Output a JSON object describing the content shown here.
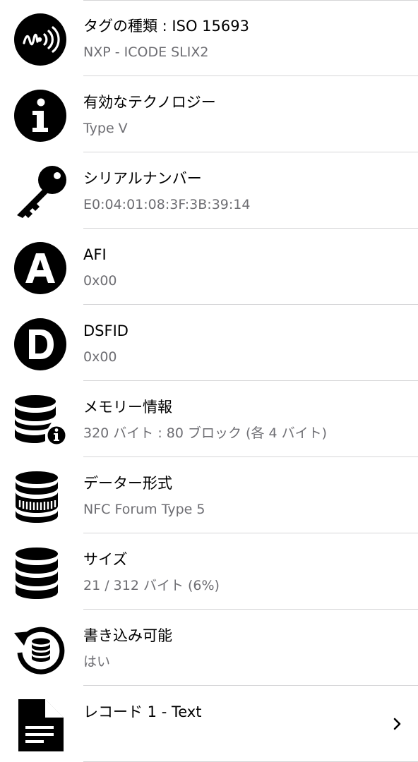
{
  "rows": [
    {
      "icon": "nfc-signal-icon",
      "title": "タグの種類 : ISO 15693",
      "value": "NXP - ICODE SLIX2"
    },
    {
      "icon": "info-icon",
      "title": "有効なテクノロジー",
      "value": "Type V"
    },
    {
      "icon": "key-icon",
      "title": "シリアルナンバー",
      "value": "E0:04:01:08:3F:3B:39:14"
    },
    {
      "icon": "letter-a-icon",
      "title": "AFI",
      "value": "0x00"
    },
    {
      "icon": "letter-d-icon",
      "title": "DSFID",
      "value": "0x00"
    },
    {
      "icon": "database-info-icon",
      "title": "メモリー情報",
      "value": "320 バイト : 80 ブロック (各 4 バイト)"
    },
    {
      "icon": "database-format-icon",
      "title": "データー形式",
      "value": "NFC Forum Type 5"
    },
    {
      "icon": "database-icon",
      "title": "サイズ",
      "value": "21 / 312 バイト (6%)"
    },
    {
      "icon": "database-rewrite-icon",
      "title": "書き込み可能",
      "value": "はい"
    },
    {
      "icon": "document-text-icon",
      "title": "レコード 1 - Text",
      "value": ""
    }
  ],
  "colors": {
    "title": "#000000",
    "value": "#6e6e73",
    "separator": "#d5d5d7",
    "icon": "#000000"
  }
}
